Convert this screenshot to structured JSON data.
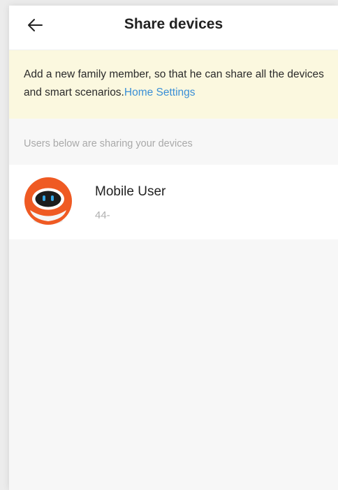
{
  "header": {
    "title": "Share devices",
    "back_icon": "arrow-left-icon"
  },
  "notice": {
    "text": "Add a new family member, so that he can share all the devices and smart scenarios.",
    "link_text": "Home Settings",
    "background": "#fbf8df",
    "link_color": "#3a8fd6"
  },
  "section": {
    "label": "Users below are sharing your devices"
  },
  "users": [
    {
      "name": "Mobile User",
      "phone": "44-",
      "avatar_icon": "robot-avatar-icon"
    }
  ],
  "colors": {
    "page_background": "#f7f7f7",
    "avatar_accent": "#ef5a23"
  }
}
